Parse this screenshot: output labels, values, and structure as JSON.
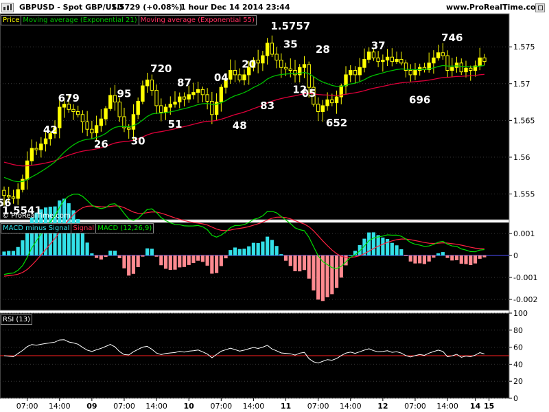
{
  "header": {
    "symbol": "GBPUSD - Spot GBP/USD",
    "price": "1.5729 (+0.08%)",
    "info": "1 hour  Dec 14 2014 23:44",
    "site": "www.ProRealTime.com"
  },
  "colors": {
    "candle": "#ffff00",
    "ema21": "#00c000",
    "ema55": "#e0003a",
    "hist_pos": "#33e0e8",
    "hist_neg": "#ff8a90",
    "macd_line": "#00e000",
    "signal_line": "#ff2040",
    "rsi_line": "#ffffff",
    "rsi_mid": "#ff2020"
  },
  "legend_price": [
    "Price",
    "Moving average (Exponential 21)",
    "Moving average (Exponential 55)"
  ],
  "legend_macd": [
    "MACD minus Signal",
    "Signal",
    "MACD (12,26,9)"
  ],
  "legend_rsi": [
    "RSI (13)"
  ],
  "watermark": "© ProRealTime.com",
  "chart_data": [
    {
      "type": "candlestick",
      "title": "GBPUSD - Spot GBP/USD 1 hour",
      "ylim": [
        1.5515,
        1.5795
      ],
      "y_ticks": [
        "1.575",
        "1.57",
        "1.565",
        "1.56",
        "1.555"
      ],
      "y_tick_values": [
        1.575,
        1.57,
        1.565,
        1.56,
        1.555
      ],
      "x_ticks": [
        "07:00",
        "14:00",
        "09",
        "07:00",
        "14:00",
        "10",
        "07:00",
        "14:00",
        "11",
        "07:00",
        "14:00",
        "12",
        "07:00",
        "14:00",
        "14",
        "15"
      ],
      "x_tick_bar_index": [
        5,
        12,
        19,
        26,
        33,
        40,
        47,
        54,
        61,
        68,
        75,
        82,
        89,
        96,
        102,
        105
      ],
      "x_tick_bold": [
        false,
        false,
        true,
        false,
        false,
        true,
        false,
        false,
        true,
        false,
        false,
        true,
        false,
        false,
        true,
        true
      ],
      "annotations": [
        "56",
        "1.5541",
        "42",
        "679",
        "26",
        "95",
        "30",
        "720",
        "51",
        "87",
        "04",
        "48",
        "20",
        "83",
        "1.5757",
        "35",
        "12",
        "05",
        "28",
        "652",
        "37",
        "696",
        "746"
      ],
      "closes": [
        1.5548,
        1.5546,
        1.5544,
        1.5556,
        1.557,
        1.5595,
        1.5612,
        1.561,
        1.5618,
        1.5625,
        1.5632,
        1.564,
        1.5668,
        1.5672,
        1.5665,
        1.5662,
        1.5658,
        1.5648,
        1.5638,
        1.5633,
        1.5643,
        1.5652,
        1.5666,
        1.5684,
        1.5675,
        1.5655,
        1.564,
        1.5638,
        1.5658,
        1.5676,
        1.5697,
        1.5705,
        1.5691,
        1.567,
        1.5661,
        1.5668,
        1.5672,
        1.5675,
        1.5682,
        1.5679,
        1.5685,
        1.5688,
        1.5692,
        1.5685,
        1.5676,
        1.5658,
        1.5675,
        1.5695,
        1.5706,
        1.5718,
        1.5712,
        1.5705,
        1.5712,
        1.5722,
        1.5732,
        1.5728,
        1.5738,
        1.5755,
        1.574,
        1.5732,
        1.5722,
        1.572,
        1.5718,
        1.5712,
        1.5722,
        1.5726,
        1.5695,
        1.5672,
        1.5662,
        1.567,
        1.5678,
        1.5674,
        1.5682,
        1.5697,
        1.5712,
        1.5718,
        1.5712,
        1.5722,
        1.5733,
        1.5743,
        1.5735,
        1.573,
        1.5732,
        1.5736,
        1.573,
        1.5733,
        1.5728,
        1.5718,
        1.5712,
        1.5718,
        1.5722,
        1.5719,
        1.5728,
        1.5735,
        1.5742,
        1.5738,
        1.5718,
        1.5722,
        1.5728,
        1.5716,
        1.5721,
        1.5718,
        1.5724,
        1.5735,
        1.573
      ]
    },
    {
      "type": "bar",
      "title": "MACD (12,26,9)",
      "series": [
        "MACD minus Signal",
        "Signal",
        "MACD (12,26,9)"
      ],
      "ylim": [
        -0.0025,
        0.0015
      ],
      "y_ticks": [
        "0.001",
        "0",
        "-0.001",
        "-0.002"
      ],
      "y_tick_values": [
        0.001,
        0,
        -0.001,
        -0.002
      ]
    },
    {
      "type": "line",
      "title": "RSI (13)",
      "ylim": [
        0,
        100
      ],
      "y_ticks": [
        "100",
        "80",
        "60",
        "40",
        "20",
        "0"
      ],
      "y_tick_values": [
        100,
        80,
        60,
        40,
        20,
        0
      ],
      "reference_line": 50
    }
  ]
}
